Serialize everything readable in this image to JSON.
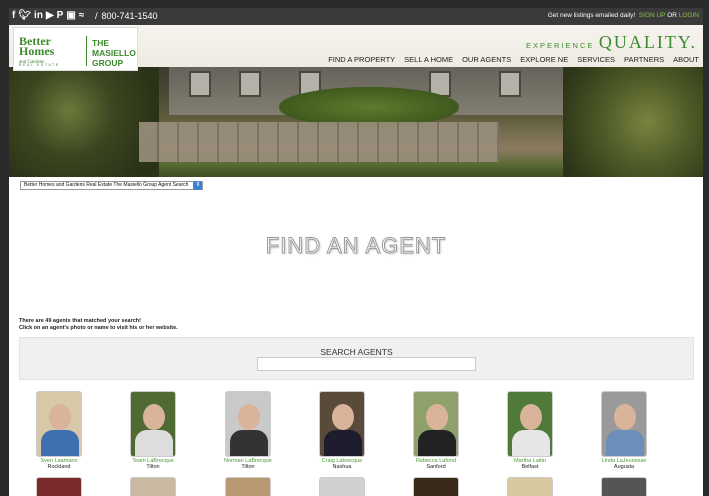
{
  "topbar": {
    "social": [
      "f",
      "t",
      "in",
      "yt",
      "p",
      "ig",
      "rss"
    ],
    "phone": "800-741-1540",
    "promo": "Get new listings emailed daily!",
    "signup": "SIGN UP",
    "or": "OR",
    "login": "LOGIN"
  },
  "logo": {
    "brand_line1": "Better",
    "brand_line2": "Homes",
    "brand_line3": "and Gardens",
    "real_estate": "REAL ESTATE",
    "group_line1": "THE",
    "group_line2": "MASIELLO",
    "group_line3": "GROUP"
  },
  "tagline": {
    "experience": "EXPERIENCE",
    "quality": "QUALITY."
  },
  "nav": [
    "FIND A PROPERTY",
    "SELL A HOME",
    "OUR AGENTS",
    "EXPLORE NE",
    "SERVICES",
    "PARTNERS",
    "ABOUT"
  ],
  "agent_select": {
    "value": "Better Homes and Gardens Real Estate The Masiello Group Agent Search"
  },
  "page_title": "FIND AN AGENT",
  "results": {
    "count_text": "There are 49 agents that matched your search!",
    "hint": "Click on an agent's photo or name to visit his or her website."
  },
  "search": {
    "label": "SEARCH AGENTS",
    "value": ""
  },
  "agents": [
    {
      "name": "Sven Laamann",
      "town": "Rockland",
      "bg": "#d7c8a8",
      "shirt": "#3f6fb0"
    },
    {
      "name": "Team LaBrecque",
      "town": "Tilton",
      "bg": "#4f6a33",
      "shirt": "#ddd"
    },
    {
      "name": "Norman LaBrecque",
      "town": "Tilton",
      "bg": "#c9c9c9",
      "shirt": "#333"
    },
    {
      "name": "Craig Labrecque",
      "town": "Nashua",
      "bg": "#5a4a3a",
      "shirt": "#1d1d2d"
    },
    {
      "name": "Rebecca Lafond",
      "town": "Sanford",
      "bg": "#8fa16a",
      "shirt": "#222"
    },
    {
      "name": "Martha Laitin",
      "town": "Belfast",
      "bg": "#4f7a3a",
      "shirt": "#e6e6e6"
    },
    {
      "name": "Linda LaJeunesse",
      "town": "Augusta",
      "bg": "#9a9a9a",
      "shirt": "#6b8fb8"
    }
  ],
  "row2_colors": [
    "#7a2a2a",
    "#c8b9a0",
    "#b89870",
    "#d0d0d0",
    "#3a2a1a",
    "#d8c8a0",
    "#555"
  ]
}
